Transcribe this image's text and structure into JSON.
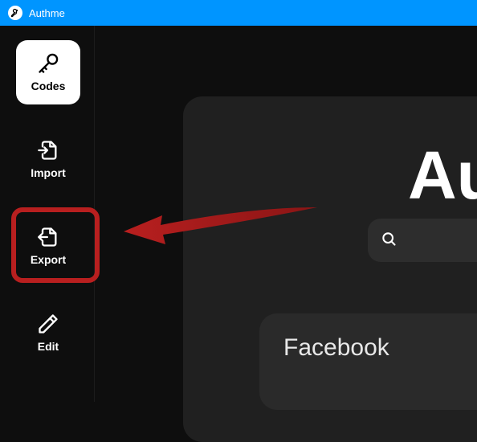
{
  "window": {
    "title": "Authme"
  },
  "sidebar": {
    "items": [
      {
        "label": "Codes",
        "active": true
      },
      {
        "label": "Import",
        "active": false
      },
      {
        "label": "Export",
        "active": false
      },
      {
        "label": "Edit",
        "active": false
      }
    ]
  },
  "main": {
    "title_partial": "Au",
    "entries": [
      {
        "name": "Facebook"
      }
    ]
  },
  "annotation": {
    "highlighted_item": "Export",
    "color": "#b81f1f"
  }
}
